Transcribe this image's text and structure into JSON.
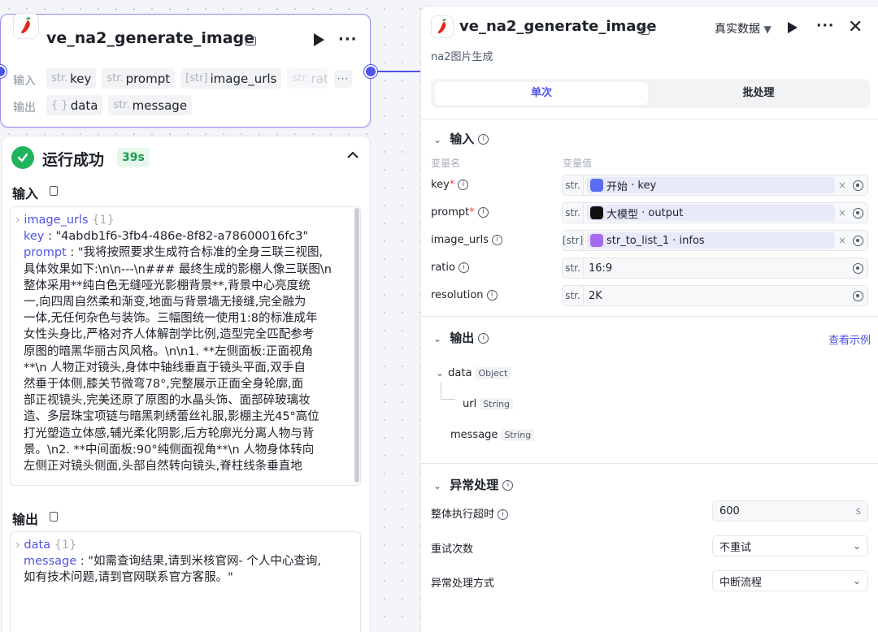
{
  "node": {
    "title": "ve_na2_generate_image",
    "input_label": "输入",
    "output_label": "输出",
    "inputs": [
      {
        "type": "str.",
        "name": "key"
      },
      {
        "type": "str.",
        "name": "prompt"
      },
      {
        "type": "[str]",
        "name": "image_urls"
      },
      {
        "type": "str.",
        "name": "rati"
      }
    ],
    "outputs": [
      {
        "type": "{ }",
        "name": "data"
      },
      {
        "type": "str.",
        "name": "message"
      }
    ],
    "more": "···"
  },
  "run_result": {
    "status": "运行成功",
    "duration": "39s",
    "input_title": "输入",
    "output_title": "输出",
    "input_entries": {
      "image_urls_key": "image_urls",
      "image_urls_count": "{1}",
      "key_key": "key",
      "key_value": "\"4abdb1f6-3fb4-486e-8f82-a78600016fc3\"",
      "prompt_key": "prompt",
      "prompt_lines": [
        "\"我将按照要求生成符合标准的全身三联三视图,",
        "具体效果如下:\\n\\n---\\n### 最终生成的影棚人像三联图\\n",
        "整体采用**纯白色无缝哑光影棚背景**,背景中心亮度统",
        "一,向四周自然柔和渐变,地面与背景墙无接缝,完全融为",
        "一体,无任何杂色与装饰。三幅图统一使用1:8的标准成年",
        "女性头身比,严格对齐人体解剖学比例,造型完全匹配参考",
        "原图的暗黑华丽古风风格。\\n\\n1. **左侧面板:正面视角",
        "**\\n   人物正对镜头,身体中轴线垂直于镜头平面,双手自",
        "然垂于体侧,膝关节微弯78°,完整展示正面全身轮廓,面",
        "部正视镜头,完美还原了原图的水晶头饰、面部碎玻璃妆",
        "造、多层珠宝项链与暗黑刺绣蕾丝礼服,影棚主光45°高位",
        "打光塑造立体感,辅光柔化阴影,后方轮廓光分离人物与背",
        "景。\\n2. **中间面板:90°纯侧面视角**\\n   人物身体转向",
        "左侧正对镜头侧面,头部自然转向镜头,脊柱线条垂直地"
      ]
    },
    "output_entries": {
      "data_key": "data",
      "data_count": "{1}",
      "message_key": "message",
      "message_lines": [
        "\"如需查询结果,请到米核官网- 个人中心查询,",
        "如有技术问题,请到官网联系官方客服。\""
      ]
    }
  },
  "side_panel": {
    "title": "ve_na2_generate_image",
    "subtitle": "na2图片生成",
    "data_mode": "真实数据",
    "tabs": [
      "单次",
      "批处理"
    ],
    "input_section": "输入",
    "col_name": "变量名",
    "col_value": "变量值",
    "params": [
      {
        "name": "key",
        "required": true,
        "type": "str.",
        "ref_node": "开始",
        "ref_field": "key",
        "ref_color": "#5a6cf0"
      },
      {
        "name": "prompt",
        "required": true,
        "type": "str.",
        "ref_node": "大模型",
        "ref_field": "output",
        "ref_color": "#111111"
      },
      {
        "name": "image_urls",
        "required": false,
        "type": "[str]",
        "ref_node": "str_to_list_1",
        "ref_field": "infos",
        "ref_color": "#a66cf0"
      },
      {
        "name": "ratio",
        "required": false,
        "type": "str.",
        "value": "16:9"
      },
      {
        "name": "resolution",
        "required": false,
        "type": "str.",
        "value": "2K"
      }
    ],
    "output_section": "输出",
    "view_example": "查看示例",
    "outputs": {
      "data": {
        "name": "data",
        "type": "Object"
      },
      "url": {
        "name": "url",
        "type": "String"
      },
      "message": {
        "name": "message",
        "type": "String"
      }
    },
    "exception_section": "异常处理",
    "timeout_label": "整体执行超时",
    "timeout_value": "600",
    "timeout_unit": "s",
    "retry_label": "重试次数",
    "retry_value": "不重试",
    "handle_label": "异常处理方式",
    "handle_value": "中断流程"
  }
}
